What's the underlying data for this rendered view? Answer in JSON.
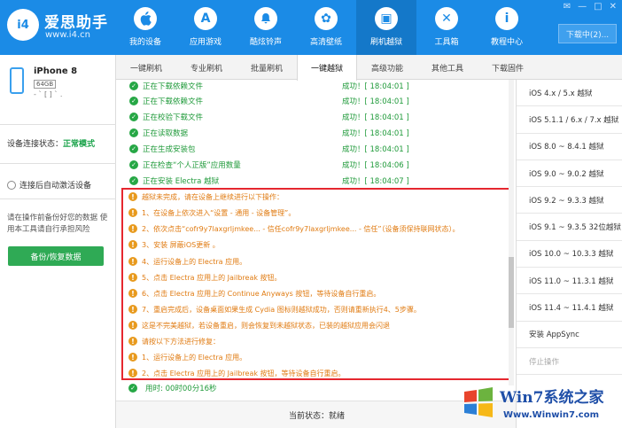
{
  "brand": {
    "name": "爱思助手",
    "url": "www.i4.cn",
    "logo_text": "i4"
  },
  "nav": [
    {
      "label": "我的设备",
      "icon": "apple-icon",
      "glyph": ""
    },
    {
      "label": "应用游戏",
      "icon": "appstore-icon",
      "glyph": "A"
    },
    {
      "label": "酷炫铃声",
      "icon": "bell-icon",
      "glyph": "♪"
    },
    {
      "label": "高清壁纸",
      "icon": "flower-icon",
      "glyph": "✿"
    },
    {
      "label": "刷机越狱",
      "icon": "box-icon",
      "glyph": "▣"
    },
    {
      "label": "工具箱",
      "icon": "wrench-icon",
      "glyph": "✕"
    },
    {
      "label": "教程中心",
      "icon": "info-icon",
      "glyph": "i"
    }
  ],
  "window": {
    "download_label": "下载中(2)...",
    "controls": [
      "✉",
      "—",
      "□",
      "✕"
    ]
  },
  "device": {
    "name": "iPhone 8",
    "capacity": "64GB",
    "extra": "-  `   [ ]  ` .",
    "connection_label": "设备连接状态：",
    "connection_value": "正常模式",
    "auto_activate": "连接后自动激活设备",
    "warning": "请在操作前备份好您的数据 使用本工具请自行承担风险",
    "backup_button": "备份/恢复数据"
  },
  "tabs": [
    "一键刷机",
    "专业刷机",
    "批量刷机",
    "一键越狱",
    "高级功能",
    "其他工具",
    "下载固件"
  ],
  "active_tab": 3,
  "log_ok": [
    {
      "text": "正在下载依赖文件",
      "result": "成功！[ 18:04:01 ]"
    },
    {
      "text": "正在下载依赖文件",
      "result": "成功！[ 18:04:01 ]"
    },
    {
      "text": "正在校验下载文件",
      "result": "成功！[ 18:04:01 ]"
    },
    {
      "text": "正在读取数据",
      "result": "成功！[ 18:04:01 ]"
    },
    {
      "text": "正在生成安装包",
      "result": "成功！[ 18:04:01 ]"
    },
    {
      "text": "正在检查“个人正版”应用数量",
      "result": "成功！[ 18:04:06 ]"
    },
    {
      "text": "正在安装 Electra 越狱",
      "result": "成功！[ 18:04:07 ]"
    }
  ],
  "log_warn": [
    "越狱未完成，请在设备上继续进行以下操作：",
    "1、在设备上依次进入“设置 - 通用 - 设备管理”。",
    "2、依次点击“cofr9y7laxgrljmkee... - 信任cofr9y7laxgrljmkee... - 信任”（设备须保持联网状态）。",
    "3、安装 屏蔽iOS更新 。",
    "4、运行设备上的 Electra 应用。",
    "5、点击 Electra 应用上的 Jailbreak 按钮。",
    "6、点击 Electra 应用上的 Continue Anyways 按钮，等待设备自行重启。",
    "7、重启完成后，设备桌面如果生成 Cydia 图标则越狱成功，否则请重新执行4、5步骤。",
    "这是不完美越狱，若设备重启，则会恢复到未越狱状态，已装的越狱应用会闪退",
    "请按以下方法进行修复：",
    "1、运行设备上的 Electra 应用。",
    "2、点击 Electra 应用上的 Jailbreak 按钮，等待设备自行重启。"
  ],
  "elapsed": "用时: 00时00分16秒",
  "status": "当前状态：就绪",
  "ios_list": [
    "iOS 4.x / 5.x 越狱",
    "iOS 5.1.1 / 6.x / 7.x 越狱",
    "iOS 8.0 ~ 8.4.1 越狱",
    "iOS 9.0 ~ 9.0.2 越狱",
    "iOS 9.2 ~ 9.3.3 越狱",
    "iOS 9.1 ~ 9.3.5 32位越狱",
    "iOS 10.0 ~ 10.3.3 越狱",
    "iOS 11.0 ~ 11.3.1 越狱",
    "iOS 11.4 ~ 11.4.1 越狱",
    "安装 AppSync",
    "停止操作"
  ],
  "watermark": {
    "name": "Win7系统之家",
    "url": "Www.Winwin7.com"
  }
}
